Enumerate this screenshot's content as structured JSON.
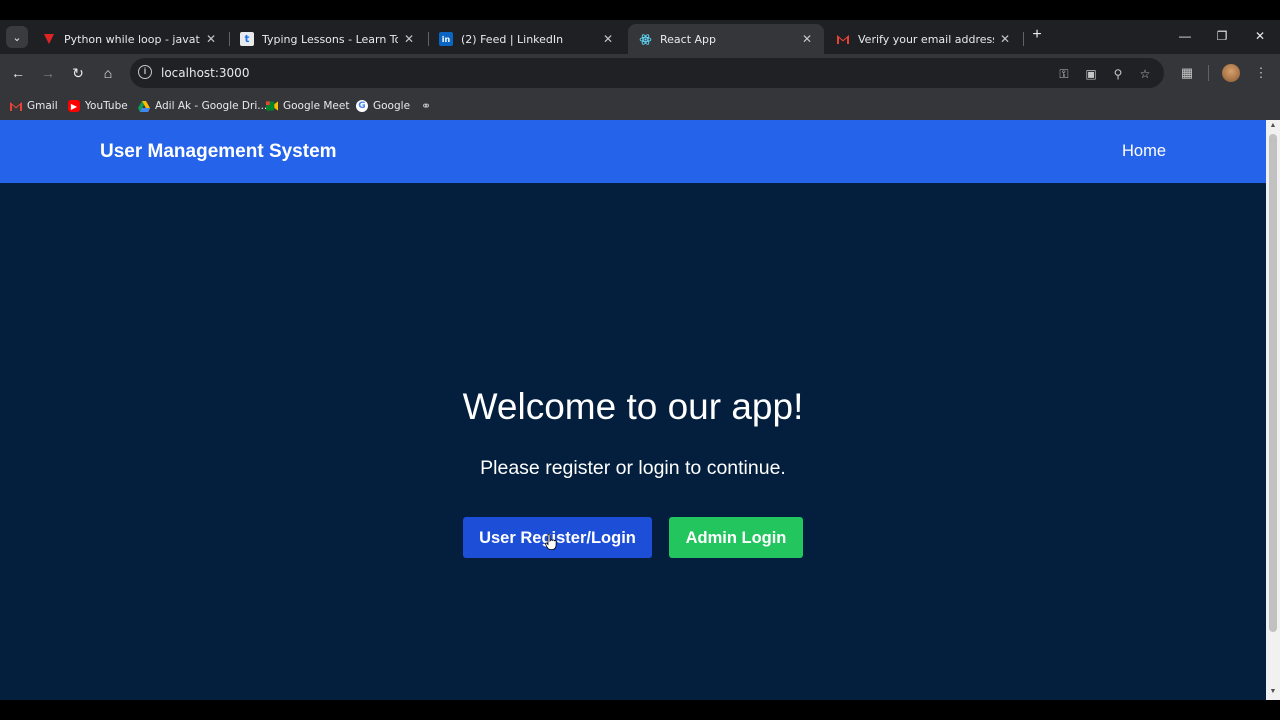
{
  "browser": {
    "tabs": [
      {
        "title": "Python while loop - javatpoint",
        "icon": "javatpoint-favicon",
        "active": false
      },
      {
        "title": "Typing Lessons - Learn To Type",
        "icon": "typing-favicon",
        "active": false
      },
      {
        "title": "(2) Feed | LinkedIn",
        "icon": "linkedin-favicon",
        "active": false
      },
      {
        "title": "React App",
        "icon": "react-favicon",
        "active": true
      },
      {
        "title": "Verify your email address - mai",
        "icon": "gmail-favicon",
        "active": false
      }
    ],
    "address": "localhost:3000",
    "bookmarks": [
      {
        "label": "Gmail",
        "icon": "gmail-icon"
      },
      {
        "label": "YouTube",
        "icon": "youtube-icon"
      },
      {
        "label": "Adil Ak - Google Dri...",
        "icon": "google-drive-icon"
      },
      {
        "label": "Google Meet",
        "icon": "google-meet-icon"
      },
      {
        "label": "Google",
        "icon": "google-icon"
      },
      {
        "label": "",
        "icon": "globe-icon"
      }
    ]
  },
  "app": {
    "brand": "User Management System",
    "nav": {
      "home": "Home"
    },
    "hero": {
      "title": "Welcome to our app!",
      "subtitle": "Please register or login to continue."
    },
    "buttons": {
      "user": "User Register/Login",
      "admin": "Admin Login"
    }
  },
  "colors": {
    "header": "#2563eb",
    "background": "#031f3d",
    "user_button": "#1d4ed8",
    "admin_button": "#22c55e"
  }
}
